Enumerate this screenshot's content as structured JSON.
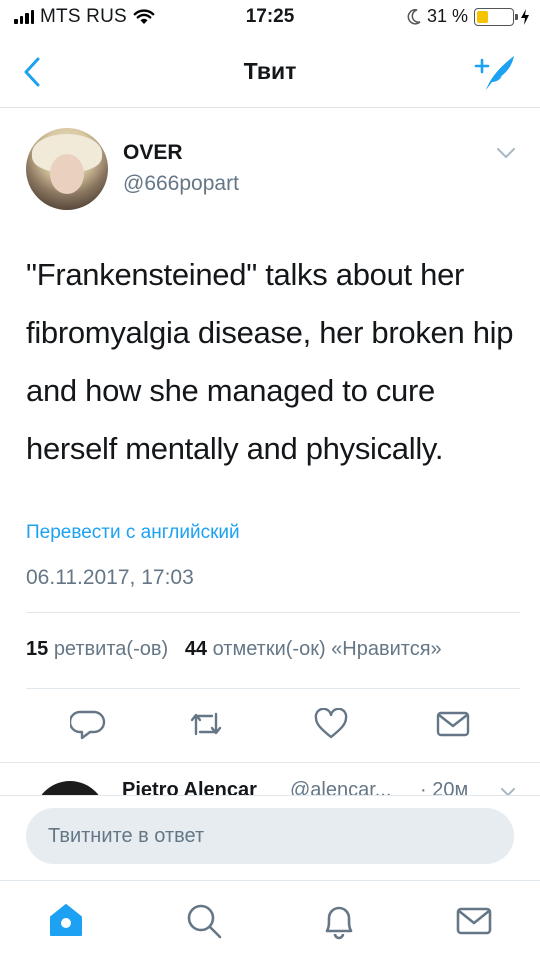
{
  "status_bar": {
    "carrier": "MTS RUS",
    "time": "17:25",
    "battery_percent": "31 %",
    "battery_level": 0.31,
    "icons": [
      "signal-icon",
      "wifi-icon",
      "moon-icon",
      "battery-icon",
      "charging-icon"
    ]
  },
  "nav": {
    "title": "Твит",
    "back_icon": "chevron-left-icon",
    "compose_icon": "compose-tweet-icon",
    "accent_color": "#1da1f2"
  },
  "tweet": {
    "display_name": "OVER",
    "handle": "@666popart",
    "text": "\"Frankensteined\" talks about her fibromyalgia disease, her broken hip and how she managed to cure herself mentally and physically.",
    "translate_label": "Перевести с английский",
    "timestamp": "06.11.2017, 17:03",
    "retweet_count": "15",
    "retweet_label": "ретвита(-ов)",
    "like_count": "44",
    "like_label": "отметки(-ок) «Нравится»"
  },
  "actions": [
    "reply-icon",
    "retweet-icon",
    "like-icon",
    "share-icon"
  ],
  "reply_preview": {
    "name": "Pietro Alencar",
    "handle": "@alencar...",
    "time": "· 20м"
  },
  "compose": {
    "placeholder": "Твитните в ответ"
  },
  "tabs": [
    "home-icon",
    "search-icon",
    "notifications-icon",
    "messages-icon"
  ]
}
